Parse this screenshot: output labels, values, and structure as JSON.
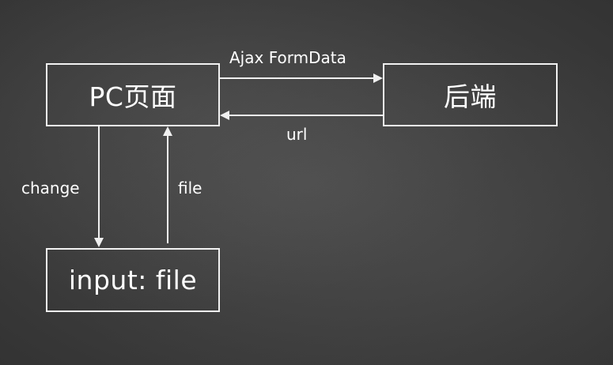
{
  "nodes": {
    "pc_page": "PC页面",
    "backend": "后端",
    "file_input": "input: file"
  },
  "edges": {
    "pc_to_backend": "Ajax FormData",
    "backend_to_pc": "url",
    "pc_to_input": "change",
    "input_to_pc": "file"
  }
}
